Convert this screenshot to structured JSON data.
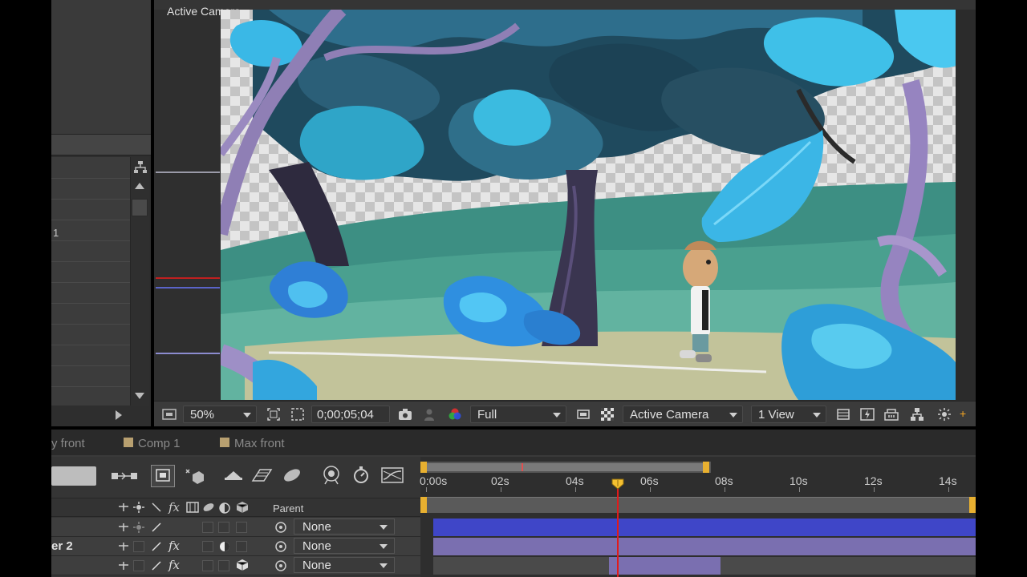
{
  "project_panel": {
    "item_number": "1"
  },
  "viewer": {
    "header_label": "Active Camera",
    "toolbar": {
      "magnification": "50%",
      "timecode": "0;00;05;04",
      "resolution": "Full",
      "camera_view": "Active Camera",
      "view_layout": "1 View"
    }
  },
  "timeline": {
    "tabs": [
      {
        "label": "y front"
      },
      {
        "label": "Comp 1"
      },
      {
        "label": "Max front"
      }
    ],
    "ruler": {
      "labels": [
        "0:00s",
        "02s",
        "04s",
        "06s",
        "08s",
        "10s",
        "12s",
        "14s"
      ],
      "current_time_seconds": 5.13,
      "work_area_end_seconds": 7.5
    },
    "columns": {
      "parent_header": "Parent"
    },
    "layers": [
      {
        "name": "",
        "parent": "None",
        "bar_start_seconds": 0.2,
        "bar_color": "#3f46c8"
      },
      {
        "name": "er 2",
        "parent": "None",
        "bar_start_seconds": 0.2,
        "bar_color": "#7a6fb0"
      },
      {
        "name": "",
        "parent": "None",
        "bar_start_seconds": 4.9,
        "bar_end_seconds": 7.9,
        "bar_color": "#7a6fb0"
      }
    ]
  },
  "colors": {
    "accent_orange": "#f5a623",
    "cti_red": "#e01b1b",
    "layer_blue": "#3f46c8",
    "layer_purple": "#7a6fb0"
  }
}
